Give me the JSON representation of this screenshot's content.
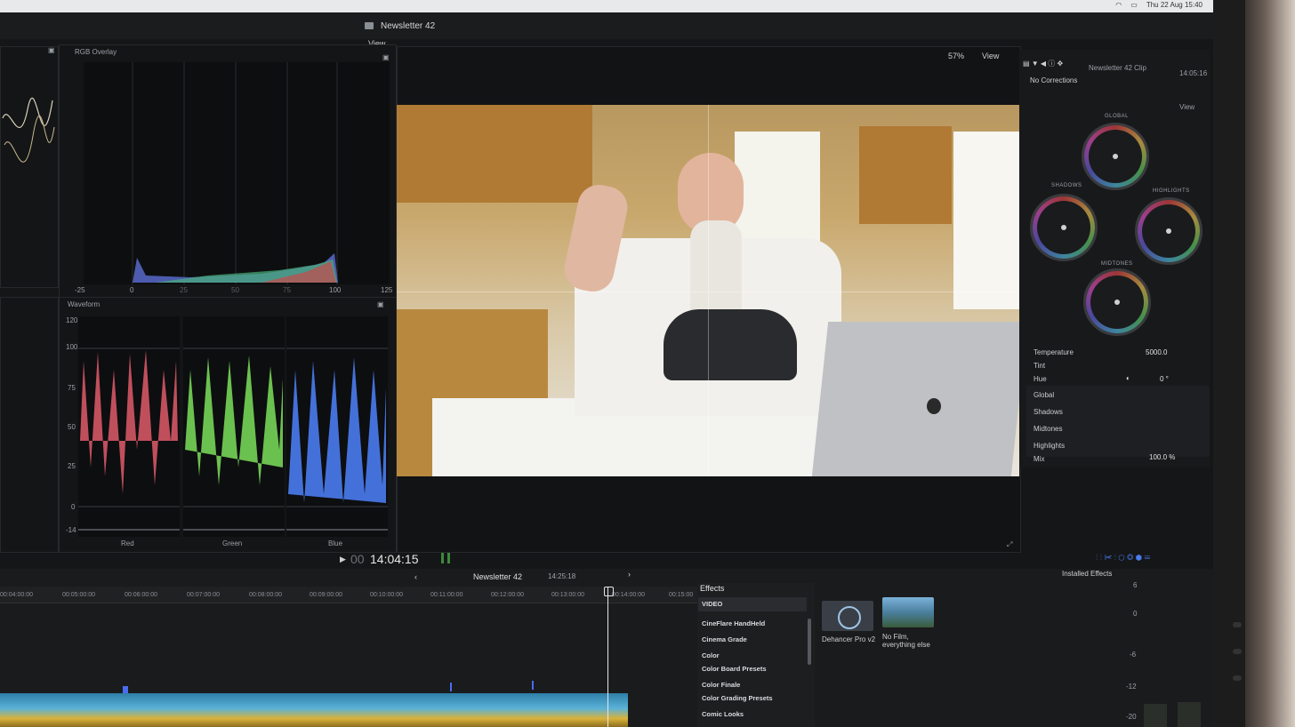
{
  "app": {
    "window_title": "Newsletter 42",
    "menubar_clock": "Thu 22 Aug 15:40"
  },
  "scopes": {
    "top_view_label": "View",
    "rgb_overlay": {
      "title": "RGB Overlay",
      "axis_labels": [
        "-25",
        "0",
        "25",
        "50",
        "75",
        "100",
        "125"
      ]
    },
    "waveform": {
      "title": "Waveform",
      "y_labels": [
        "120",
        "100",
        "75",
        "50",
        "25",
        "0",
        "-14"
      ],
      "channels": [
        "Red",
        "Green",
        "Blue"
      ]
    }
  },
  "viewer": {
    "zoom": "57%",
    "view_label": "View",
    "timecode_prefix": "00",
    "timecode": "14:04:15"
  },
  "inspector": {
    "clip_name": "Newsletter 42 Clip",
    "clip_time": "14:05:16",
    "corrections": "No Corrections",
    "view_label": "View",
    "wheels": [
      "GLOBAL",
      "SHADOWS",
      "HIGHLIGHTS",
      "MIDTONES"
    ],
    "params": [
      {
        "label": "Temperature",
        "value": "5000.0"
      },
      {
        "label": "Tint",
        "value": ""
      },
      {
        "label": "Hue",
        "value": "0 °"
      }
    ],
    "sections": [
      "Global",
      "Shadows",
      "Midtones",
      "Highlights"
    ],
    "mix": {
      "label": "Mix",
      "value": "100.0 %"
    }
  },
  "timeline": {
    "project_name": "Newsletter 42",
    "duration": "14:25:18",
    "ruler_ticks": [
      "00:04:00:00",
      "00:05:00:00",
      "00:06:00:00",
      "00:07:00:00",
      "00:08:00:00",
      "00:09:00:00",
      "00:10:00:00",
      "00:11:00:00",
      "00:12:00:00",
      "00:13:00:00",
      "00:14:00:00",
      "00:15:00"
    ]
  },
  "effects": {
    "title": "Effects",
    "installed_label": "Installed Effects",
    "categories": [
      "VIDEO",
      "CineFlare HandHeld",
      "Cinema Grade",
      "Color",
      "Color Board Presets",
      "Color Finale",
      "Color Grading Presets",
      "Comic Looks"
    ],
    "items": [
      {
        "name": "Dehancer Pro v2"
      },
      {
        "name": "No Film, everything else"
      }
    ],
    "meter_labels": [
      "6",
      "0",
      "-6",
      "-12",
      "-20"
    ]
  }
}
